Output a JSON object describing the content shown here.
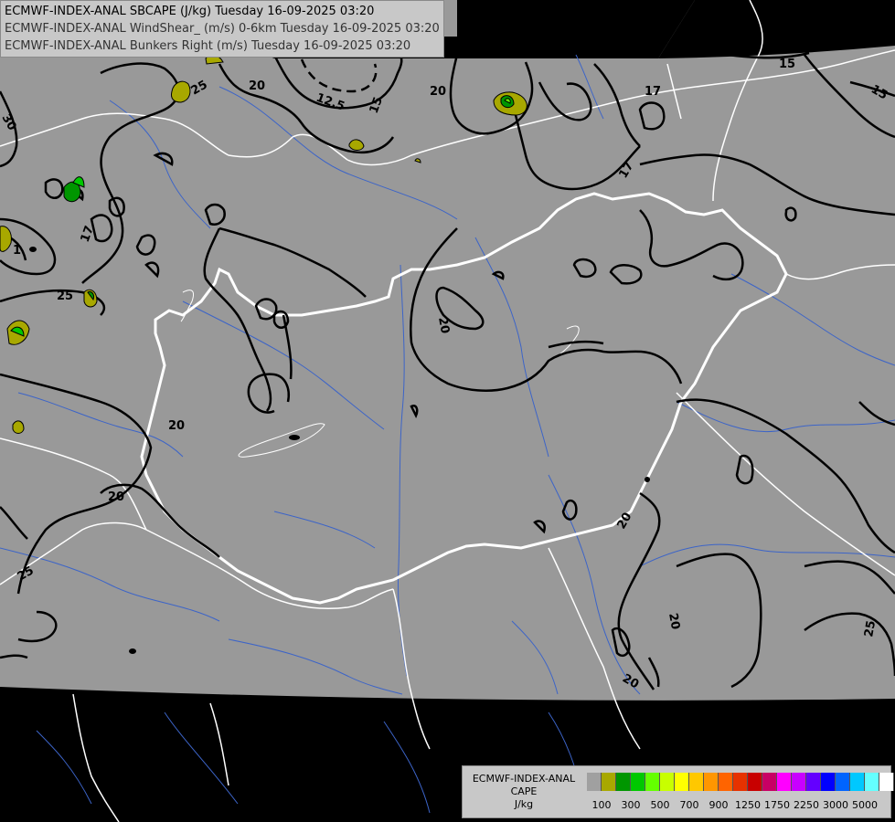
{
  "header": {
    "lines": [
      "ECMWF-INDEX-ANAL SBCAPE (J/kg) Tuesday 16-09-2025 03:20",
      "ECMWF-INDEX-ANAL WindShear_ (m/s) 0-6km Tuesday 16-09-2025 03:20",
      "ECMWF-INDEX-ANAL Bunkers Right (m/s) Tuesday 16-09-2025 03:20"
    ]
  },
  "legend": {
    "label_lines": [
      "ECMWF-INDEX-ANAL",
      "CAPE",
      "J/kg"
    ],
    "colors": [
      "#a0a0a0",
      "#a8a800",
      "#009600",
      "#00c800",
      "#64ff00",
      "#c8ff00",
      "#ffff00",
      "#ffc800",
      "#ff9600",
      "#ff6400",
      "#e63200",
      "#c80000",
      "#c80064",
      "#ff00ff",
      "#c800ff",
      "#6400ff",
      "#0000ff",
      "#0064ff",
      "#00c8ff",
      "#64ffff",
      "#ffffff"
    ],
    "ticks": [
      "100",
      "300",
      "500",
      "700",
      "900",
      "1250",
      "1750",
      "2250",
      "3000",
      "5000"
    ]
  },
  "map": {
    "colors": {
      "data_area": "#999999",
      "outside": "#000000",
      "border": "#ffffff",
      "river": "#3c64c8",
      "contour": "#000000"
    },
    "contour_labels": [
      "30",
      "25",
      "20",
      "12.5",
      "15",
      "20",
      "17",
      "15",
      "15",
      "17",
      "17",
      "1",
      "25",
      "20",
      "20",
      "20",
      "20",
      "25",
      "20",
      "20",
      "25"
    ]
  }
}
